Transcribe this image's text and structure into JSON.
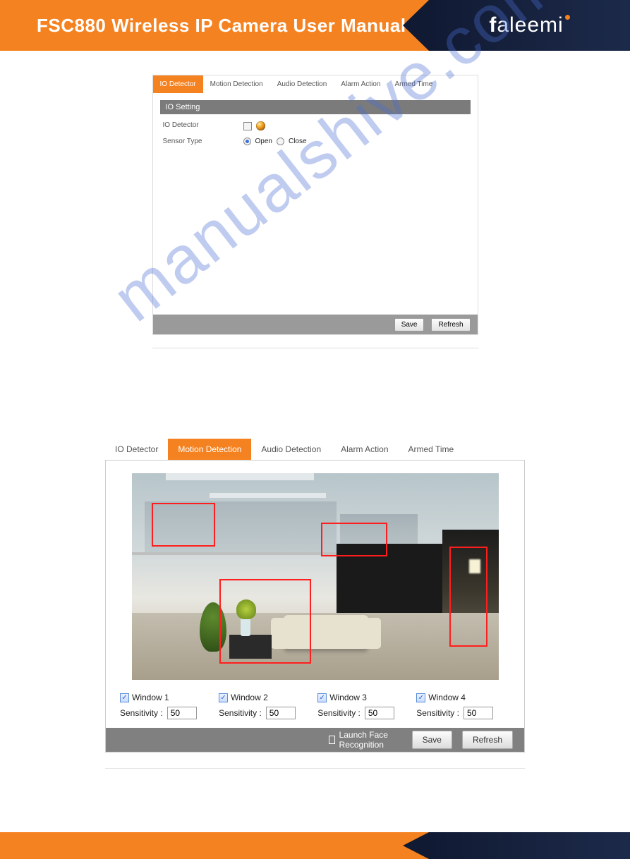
{
  "header": {
    "title": "FSC880 Wireless IP Camera User Manual",
    "brand": "faleemi"
  },
  "watermark": "manualshive.com",
  "screenshot1": {
    "tabs": [
      "IO Detector",
      "Motion Detection",
      "Audio Detection",
      "Alarm Action",
      "Armed Time"
    ],
    "active_tab": 0,
    "section_title": "IO Setting",
    "row_io_label": "IO Detector",
    "row_sensor_label": "Sensor Type",
    "sensor_open": "Open",
    "sensor_close": "Close",
    "save": "Save",
    "refresh": "Refresh"
  },
  "screenshot2": {
    "tabs": [
      "IO Detector",
      "Motion Detection",
      "Audio Detection",
      "Alarm Action",
      "Armed Time"
    ],
    "active_tab": 1,
    "windows": [
      {
        "label": "Window 1",
        "sensitivity_label": "Sensitivity :",
        "value": "50"
      },
      {
        "label": "Window 2",
        "sensitivity_label": "Sensitivity :",
        "value": "50"
      },
      {
        "label": "Window 3",
        "sensitivity_label": "Sensitivity :",
        "value": "50"
      },
      {
        "label": "Window 4",
        "sensitivity_label": "Sensitivity :",
        "value": "50"
      }
    ],
    "launch_face": "Launch Face Recognition",
    "save": "Save",
    "refresh": "Refresh"
  }
}
